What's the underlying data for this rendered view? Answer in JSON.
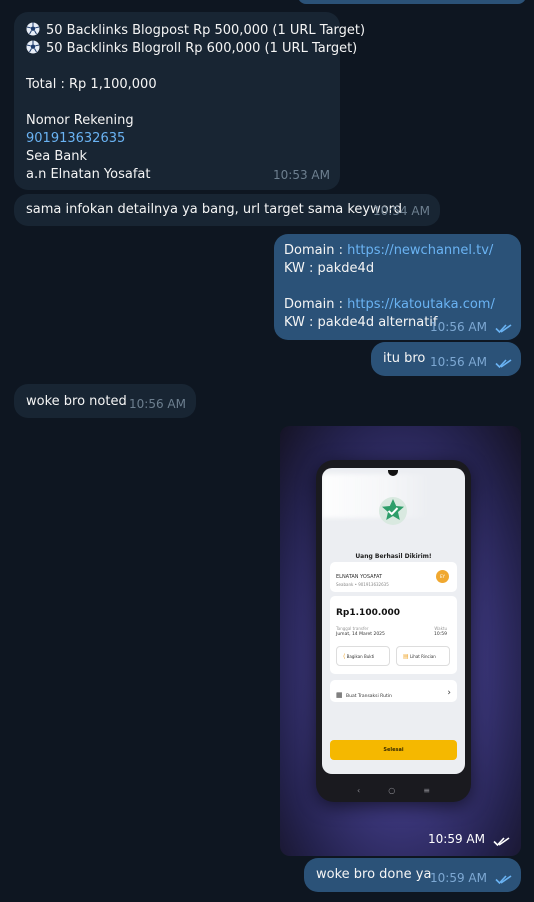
{
  "messages": {
    "m1": {
      "line1": "50 Backlinks Blogpost Rp 500,000 (1 URL Target)",
      "line2": "50 Backlinks Blogroll Rp 600,000 (1 URL Target)",
      "total": "Total : Rp 1,100,000",
      "bank_heading": "Nomor Rekening",
      "account_number": "901913632635",
      "bank_name": "Sea Bank",
      "account_name": "a.n Elnatan Yosafat",
      "time": "10:53 AM",
      "icon": "soccer-ball-icon"
    },
    "m2": {
      "text": "sama infokan detailnya ya bang, url target sama keyword",
      "time": "10:54 AM"
    },
    "m3": {
      "domain1_label": "Domain : ",
      "domain1_url": "https://newchannel.tv/",
      "kw1": "KW : pakde4d",
      "domain2_label": "Domain : ",
      "domain2_url": "https://katoutaka.com/",
      "kw2": "KW : pakde4d alternatif",
      "time": "10:56 AM"
    },
    "m4": {
      "text": "itu bro",
      "time": "10:56 AM"
    },
    "m5": {
      "text": "woke bro noted",
      "time": "10:56 AM"
    },
    "m6": {
      "time": "10:59 AM",
      "phone": {
        "success_title": "Uang Berhasil Dikirim!",
        "recipient_name": "ELNATAN YOSAFAT",
        "recipient_sub": "Seabank • 901913632635",
        "avatar_initials": "EY",
        "amount": "Rp1.100.000",
        "date_label": "Tanggal transfer",
        "date_value": "Jumat, 14 Maret 2025",
        "time_label": "Waktu",
        "time_value": "10:59",
        "share_label": "Bagikan Bukti",
        "details_label": "Lihat Rincian",
        "routine_label": "Buat Transaksi Rutin",
        "done_button": "Selesai"
      }
    },
    "m7": {
      "text": "woke bro done ya",
      "time": "10:59 AM"
    }
  },
  "colors": {
    "background": "#0e1621",
    "incoming_bubble": "#182533",
    "outgoing_bubble": "#2b5278",
    "link": "#6ab3f3",
    "read_ticks": "#6ab3f3",
    "phone_accent": "#f5b800",
    "success_green": "#2e9e6a"
  }
}
